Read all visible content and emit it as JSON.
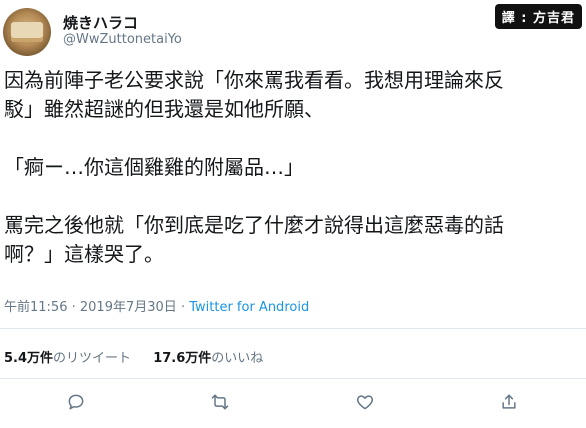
{
  "user": {
    "display_name": "焼きハラコ",
    "handle": "@WwZuttonetaiYo"
  },
  "watermark": "譯 : 方吉君",
  "tweet": {
    "lines": [
      "因為前陣子老公要求說「你來罵我看看。我想用理論來反",
      "駁」雖然超謎的但我還是如他所願、",
      "",
      "「痾ー…你這個雞雞的附屬品…」",
      "",
      "罵完之後他就「你到底是吃了什麼才說得出這麼惡毒的話",
      "啊？」這樣哭了。"
    ]
  },
  "meta": {
    "time": "午前11:56",
    "separator": "·",
    "date": "2019年7月30日",
    "source": "Twitter for Android"
  },
  "stats": {
    "retweets_count": "5.4万件",
    "retweets_label": "のリツイート",
    "likes_count": "17.6万件",
    "likes_label": "のいいね"
  },
  "icons": {
    "reply": "reply-icon",
    "retweet": "retweet-icon",
    "like": "heart-icon",
    "share": "share-icon"
  },
  "colors": {
    "text": "#14171a",
    "muted": "#657786",
    "link": "#1b95e0",
    "divider": "#e1e8ed"
  }
}
